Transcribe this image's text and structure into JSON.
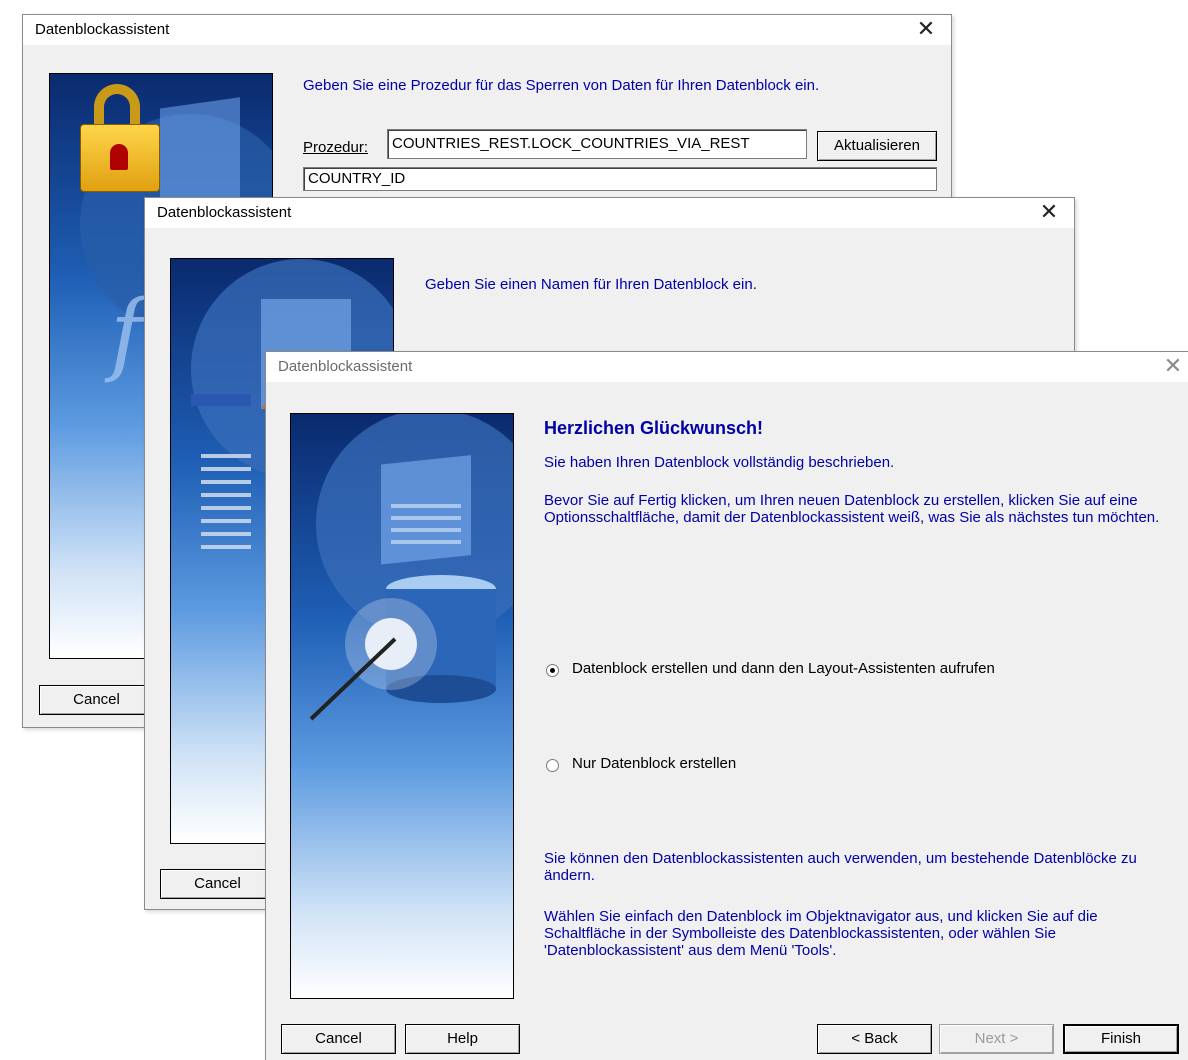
{
  "window1": {
    "title": "Datenblockassistent",
    "instruction": "Geben Sie eine Prozedur für das Sperren von Daten für Ihren Datenblock ein.",
    "procedure_label": "Prozedur:",
    "procedure_value": "COUNTRIES_REST.LOCK_COUNTRIES_VIA_REST",
    "refresh_button": "Aktualisieren",
    "list_value": "COUNTRY_ID",
    "cancel_button": "Cancel"
  },
  "window2": {
    "title": "Datenblockassistent",
    "instruction": "Geben Sie einen Namen für Ihren Datenblock ein.",
    "cancel_button": "Cancel"
  },
  "window3": {
    "title": "Datenblockassistent",
    "heading": "Herzlichen Glückwunsch!",
    "line1": "Sie haben Ihren Datenblock vollständig beschrieben.",
    "line2": "Bevor Sie auf Fertig klicken, um Ihren neuen Datenblock zu erstellen, klicken Sie auf eine Optionsschaltfläche, damit der Datenblockassistent weiß, was Sie als nächstes tun möchten.",
    "option1": "Datenblock erstellen und dann den Layout-Assistenten aufrufen",
    "option2": "Nur Datenblock erstellen",
    "option1_selected": true,
    "note1": "Sie können den Datenblockassistenten auch verwenden, um bestehende Datenblöcke zu ändern.",
    "note2": "Wählen Sie einfach den Datenblock im Objektnavigator aus, und klicken Sie auf die Schaltfläche in der Symbolleiste des Datenblockassistenten, oder wählen Sie 'Datenblockassistent' aus dem Menü 'Tools'.",
    "buttons": {
      "cancel": "Cancel",
      "help": "Help",
      "back": "< Back",
      "next": "Next >",
      "finish": "Finish"
    }
  },
  "colors": {
    "instruction_text": "#0000a8",
    "dialog_bg": "#f0f0f0"
  }
}
